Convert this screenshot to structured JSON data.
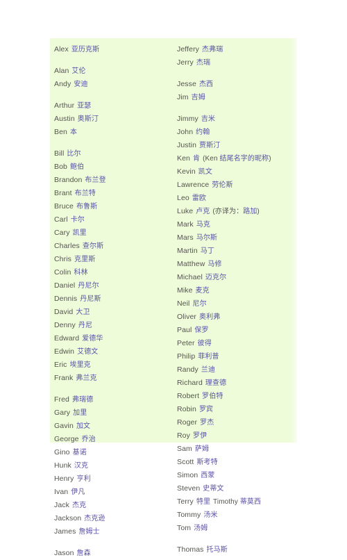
{
  "page": {
    "title": "English Given Names with Chinese Transliterations",
    "background_color": "#ffffff",
    "panel_color": "#eefcd9",
    "english_text_color": "#55544f",
    "chinese_text_color": "#5b52a8"
  },
  "columns": [
    {
      "name": "left-column",
      "entries": [
        {
          "en": "Alex",
          "cn": "亚历克斯",
          "gap_before": false
        },
        {
          "en": "Alan",
          "cn": "艾伦",
          "gap_before": true
        },
        {
          "en": "Andy",
          "cn": "安迪",
          "gap_before": false
        },
        {
          "en": "Arthur",
          "cn": "亚瑟",
          "gap_before": true
        },
        {
          "en": "Austin",
          "cn": "奥斯汀",
          "gap_before": false
        },
        {
          "en": "Ben",
          "cn": "本",
          "gap_before": false
        },
        {
          "en": "Bill",
          "cn": "比尔",
          "gap_before": true
        },
        {
          "en": "Bob",
          "cn": "鲍伯",
          "gap_before": false
        },
        {
          "en": "Brandon",
          "cn": "布兰登",
          "gap_before": false
        },
        {
          "en": "Brant",
          "cn": "布兰特",
          "gap_before": false
        },
        {
          "en": "Bruce",
          "cn": "布鲁斯",
          "gap_before": false
        },
        {
          "en": "Carl",
          "cn": "卡尔",
          "gap_before": false
        },
        {
          "en": "Cary",
          "cn": "凯里",
          "gap_before": false
        },
        {
          "en": "Charles",
          "cn": "查尔斯",
          "gap_before": false
        },
        {
          "en": "Chris",
          "cn": "克里斯",
          "gap_before": false
        },
        {
          "en": "Colin",
          "cn": "科林",
          "gap_before": false
        },
        {
          "en": "Daniel",
          "cn": "丹尼尔",
          "gap_before": false
        },
        {
          "en": "Dennis",
          "cn": "丹尼斯",
          "gap_before": false
        },
        {
          "en": "David",
          "cn": "大卫",
          "gap_before": false
        },
        {
          "en": "Denny",
          "cn": "丹尼",
          "gap_before": false
        },
        {
          "en": "Edward",
          "cn": "爱德华",
          "gap_before": false
        },
        {
          "en": "Edwin",
          "cn": "艾德文",
          "gap_before": false
        },
        {
          "en": "Eric",
          "cn": "埃里克",
          "gap_before": false
        },
        {
          "en": "Frank",
          "cn": "弗兰克",
          "gap_before": false
        },
        {
          "en": "Fred",
          "cn": "弗瑞德",
          "gap_before": true
        },
        {
          "en": "Gary",
          "cn": "加里",
          "gap_before": false
        },
        {
          "en": "Gavin",
          "cn": "加文",
          "gap_before": false
        },
        {
          "en": "George",
          "cn": "乔治",
          "gap_before": false
        },
        {
          "en": "Gino",
          "cn": "基诺",
          "gap_before": false
        },
        {
          "en": "Hunk",
          "cn": "汉克",
          "gap_before": false
        },
        {
          "en": "Henry",
          "cn": "亨利",
          "gap_before": false
        },
        {
          "en": "Ivan",
          "cn": "伊凡",
          "gap_before": false
        },
        {
          "en": "Jack",
          "cn": "杰克",
          "gap_before": false
        },
        {
          "en": "Jackson",
          "cn": "杰克逊",
          "gap_before": false
        },
        {
          "en": "James",
          "cn": "詹姆士",
          "gap_before": false
        },
        {
          "en": "Jason",
          "cn": "詹森",
          "gap_before": true
        }
      ]
    },
    {
      "name": "right-column",
      "entries": [
        {
          "en": "Jeffery",
          "cn": "杰弗瑞",
          "gap_before": false
        },
        {
          "en": "Jerry",
          "cn": "杰瑞",
          "gap_before": false
        },
        {
          "en": "Jesse",
          "cn": "杰西",
          "gap_before": true
        },
        {
          "en": "Jim",
          "cn": "吉姆",
          "gap_before": false
        },
        {
          "en": "Jimmy",
          "cn": "吉米",
          "gap_before": true
        },
        {
          "en": "John",
          "cn": "约翰",
          "gap_before": false
        },
        {
          "en": "Justin",
          "cn": "贾斯汀",
          "gap_before": false
        },
        {
          "en": "Ken",
          "cn": "肯",
          "note_prefix": "(Ken ",
          "note_cn": "结尾名字的昵称",
          "note_suffix": ")",
          "gap_before": false
        },
        {
          "en": "Kevin",
          "cn": "凯文",
          "gap_before": false
        },
        {
          "en": "Lawrence",
          "cn": "劳伦斯",
          "gap_before": false
        },
        {
          "en": "Leo",
          "cn": "雷欧",
          "gap_before": false
        },
        {
          "en": "Luke",
          "cn": "卢克",
          "note_prefix": "(亦译为：",
          "note_cn": "路加",
          "note_suffix": ")",
          "gap_before": false
        },
        {
          "en": "Mark",
          "cn": "马克",
          "gap_before": false
        },
        {
          "en": "Mars",
          "cn": "马尔斯",
          "gap_before": false
        },
        {
          "en": "Martin",
          "cn": "马丁",
          "gap_before": false
        },
        {
          "en": "Matthew",
          "cn": "马修",
          "gap_before": false
        },
        {
          "en": "Michael",
          "cn": "迈克尔",
          "gap_before": false
        },
        {
          "en": "Mike",
          "cn": "麦克",
          "gap_before": false
        },
        {
          "en": "Neil",
          "cn": "尼尔",
          "gap_before": false
        },
        {
          "en": "Oliver",
          "cn": "奥利弗",
          "gap_before": false
        },
        {
          "en": "Paul",
          "cn": "保罗",
          "gap_before": false
        },
        {
          "en": "Peter",
          "cn": "彼得",
          "gap_before": false
        },
        {
          "en": "Philip",
          "cn": "菲利普",
          "gap_before": false
        },
        {
          "en": "Randy",
          "cn": "兰迪",
          "gap_before": false
        },
        {
          "en": "Richard",
          "cn": "理查德",
          "gap_before": false
        },
        {
          "en": "Robert",
          "cn": "罗伯特",
          "gap_before": false
        },
        {
          "en": "Robin",
          "cn": "罗宾",
          "gap_before": false
        },
        {
          "en": "Roger",
          "cn": "罗杰",
          "gap_before": false
        },
        {
          "en": "Roy",
          "cn": "罗伊",
          "gap_before": false
        },
        {
          "en": "Sam",
          "cn": "萨姆",
          "gap_before": false
        },
        {
          "en": "Scott",
          "cn": "斯考特",
          "gap_before": false
        },
        {
          "en": "Simon",
          "cn": "西蒙",
          "gap_before": false
        },
        {
          "en": "Steven",
          "cn": "史蒂文",
          "gap_before": false
        },
        {
          "en": "Terry",
          "cn": "特里",
          "note_prefix": "Timothy ",
          "note_cn": "蒂莫西",
          "note_suffix": "",
          "gap_before": false
        },
        {
          "en": "Tommy",
          "cn": "汤米",
          "gap_before": false
        },
        {
          "en": "Tom",
          "cn": "汤姆",
          "gap_before": false
        },
        {
          "en": "Thomas",
          "cn": "托马斯",
          "gap_before": true
        }
      ]
    }
  ]
}
